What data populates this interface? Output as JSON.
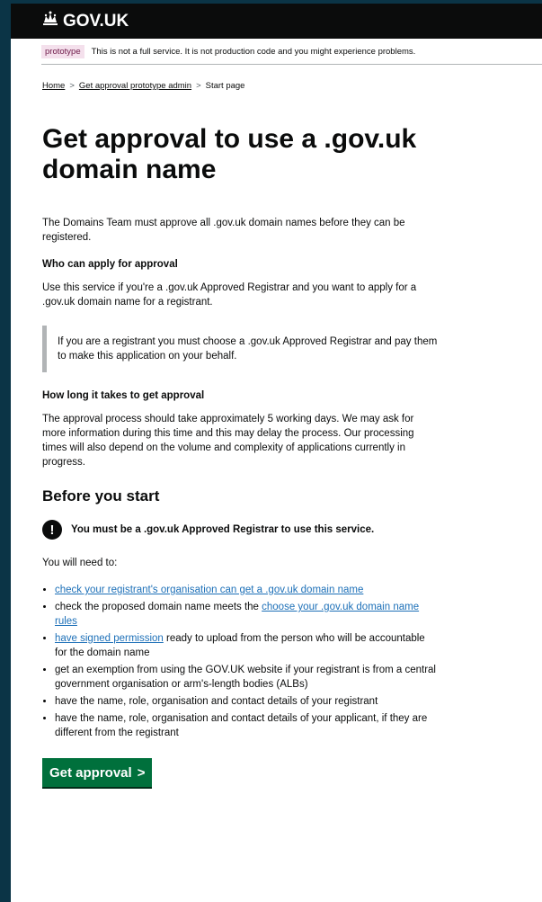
{
  "header": {
    "logo_text": "GOV.UK"
  },
  "phase_banner": {
    "tag": "prototype",
    "text": "This is not a full service. It is not production code and you might experience problems."
  },
  "breadcrumb": {
    "home": "Home",
    "admin": "Get approval prototype admin",
    "current": "Start page",
    "separator": ">"
  },
  "main": {
    "title": "Get approval to use a .gov.uk domain name",
    "intro": "The Domains Team must approve all .gov.uk domain names before they can be registered.",
    "who_heading": "Who can apply for approval",
    "who_text": "Use this service if you're a .gov.uk Approved Registrar and you want to apply for a .gov.uk domain name for a registrant.",
    "inset_text": "If you are a registrant you must choose a .gov.uk Approved Registrar and pay them to make this application on your behalf.",
    "how_long_heading": "How long it takes to get approval",
    "how_long_text": "The approval process should take approximately 5 working days. We may ask for more information during this time and this may delay the process. Our processing times will also depend on the volume and complexity of applications currently in progress.",
    "before_heading": "Before you start",
    "warning_icon": "!",
    "warning_text": "You must be a .gov.uk Approved Registrar to use this service.",
    "need_text": "You will need to:",
    "list": {
      "item1_link": "check your registrant's organisation can get a .gov.uk domain name",
      "item2_text": "check the proposed domain name meets the ",
      "item2_link": "choose your .gov.uk domain name rules",
      "item3_link": "have signed permission",
      "item3_text": " ready to upload from the person who will be accountable for the domain name",
      "item4_text": "get an exemption from using the GOV.UK website if your registrant is from a central government organisation or arm's-length bodies (ALBs)",
      "item5_text": "have the name, role, organisation and contact details of your registrant",
      "item6_text": "have the name, role, organisation and contact details of your applicant, if they are different from the registrant"
    },
    "start_button": "Get approval",
    "start_button_arrow": ">"
  },
  "colors": {
    "header_bg": "#0b0c0c",
    "link": "#1d70b8",
    "button": "#00703c",
    "tag_bg": "#f4e0ec"
  }
}
